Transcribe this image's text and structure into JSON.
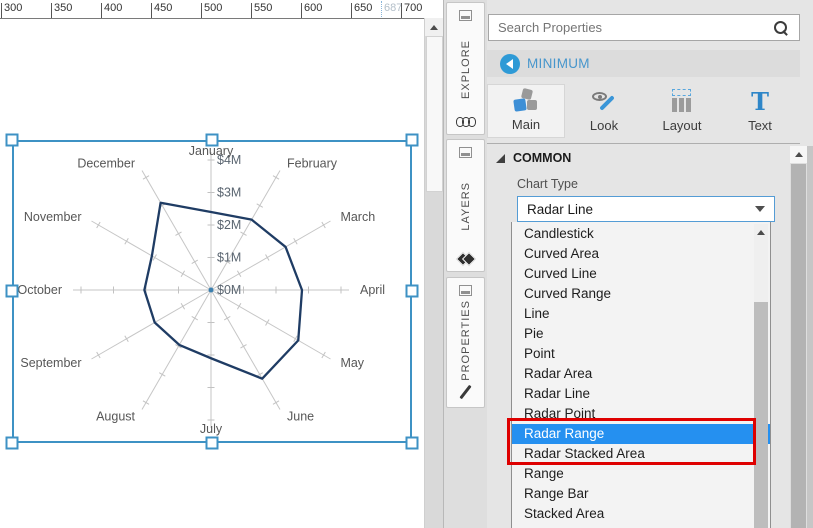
{
  "ruler": {
    "unit_ticks": [
      "300",
      "350",
      "400",
      "450",
      "500",
      "550",
      "600",
      "650",
      "700"
    ],
    "cursor_position": "687"
  },
  "side_tabs": {
    "explore": "EXPLORE",
    "layers": "LAYERS",
    "properties": "PROPERTIES"
  },
  "panel": {
    "search_placeholder": "Search Properties",
    "breadcrumb": "MINIMUM",
    "tabs": {
      "main": "Main",
      "look": "Look",
      "layout": "Layout",
      "text": "Text"
    },
    "section_title": "COMMON",
    "field_label": "Chart Type",
    "combobox_value": "Radar Line",
    "options": [
      "Candlestick",
      "Curved Area",
      "Curved Line",
      "Curved Range",
      "Line",
      "Pie",
      "Point",
      "Radar Area",
      "Radar Line",
      "Radar Point",
      "Radar Range",
      "Radar Stacked Area",
      "Range",
      "Range Bar",
      "Stacked Area"
    ],
    "highlighted_option": "Radar Range",
    "annotated_options": [
      "Radar Range",
      "Radar Stacked Area"
    ],
    "annotation_color": "#de0000",
    "selection_color": "#2590f0"
  },
  "chart_data": {
    "type": "line",
    "variant": "radar",
    "categories": [
      "January",
      "February",
      "March",
      "April",
      "May",
      "June",
      "July",
      "August",
      "September",
      "October",
      "November",
      "December"
    ],
    "series": [
      {
        "name": "MINIMUM",
        "values": [
          2.4,
          2.5,
          2.65,
          2.8,
          3.1,
          3.15,
          2.1,
          1.95,
          2.0,
          2.05,
          2.1,
          3.1
        ]
      }
    ],
    "value_unit": "$M",
    "radial_axis": {
      "ticks": [
        "$0M",
        "$1M",
        "$2M",
        "$3M",
        "$4M"
      ],
      "min": 0,
      "max": 4
    },
    "legend": "none",
    "grid": "radial-spokes-with-ticks",
    "line_color": "#1f3c64"
  },
  "colors": {
    "designer_selection": "#3e92c4",
    "accent_blue": "#2e9ad6"
  }
}
